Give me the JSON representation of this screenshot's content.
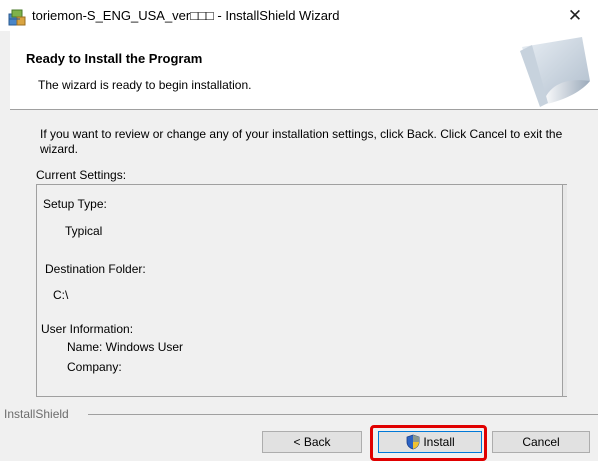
{
  "window": {
    "title": "toriemon-S_ENG_USA_ver□□□ - InstallShield Wizard",
    "close_glyph": "✕"
  },
  "header": {
    "title": "Ready to Install the Program",
    "subtitle": "The wizard is ready to begin installation.",
    "art_icon": "page-curl-art"
  },
  "body": {
    "instructions": "If you want to review or change any of your installation settings, click Back. Click Cancel to exit the wizard.",
    "current_settings_label": "Current Settings:",
    "settings": {
      "setup_type_label": "Setup Type:",
      "setup_type_value": "Typical",
      "destination_label": "Destination Folder:",
      "destination_value": "C:\\",
      "user_info_label": "User Information:",
      "name_line": "Name: Windows User",
      "company_line": "Company:"
    }
  },
  "footer": {
    "brand": "InstallShield",
    "buttons": {
      "back": "< Back",
      "install": "Install",
      "cancel": "Cancel"
    }
  },
  "colors": {
    "highlight": "#e00000",
    "default_button_border": "#0078d7"
  }
}
